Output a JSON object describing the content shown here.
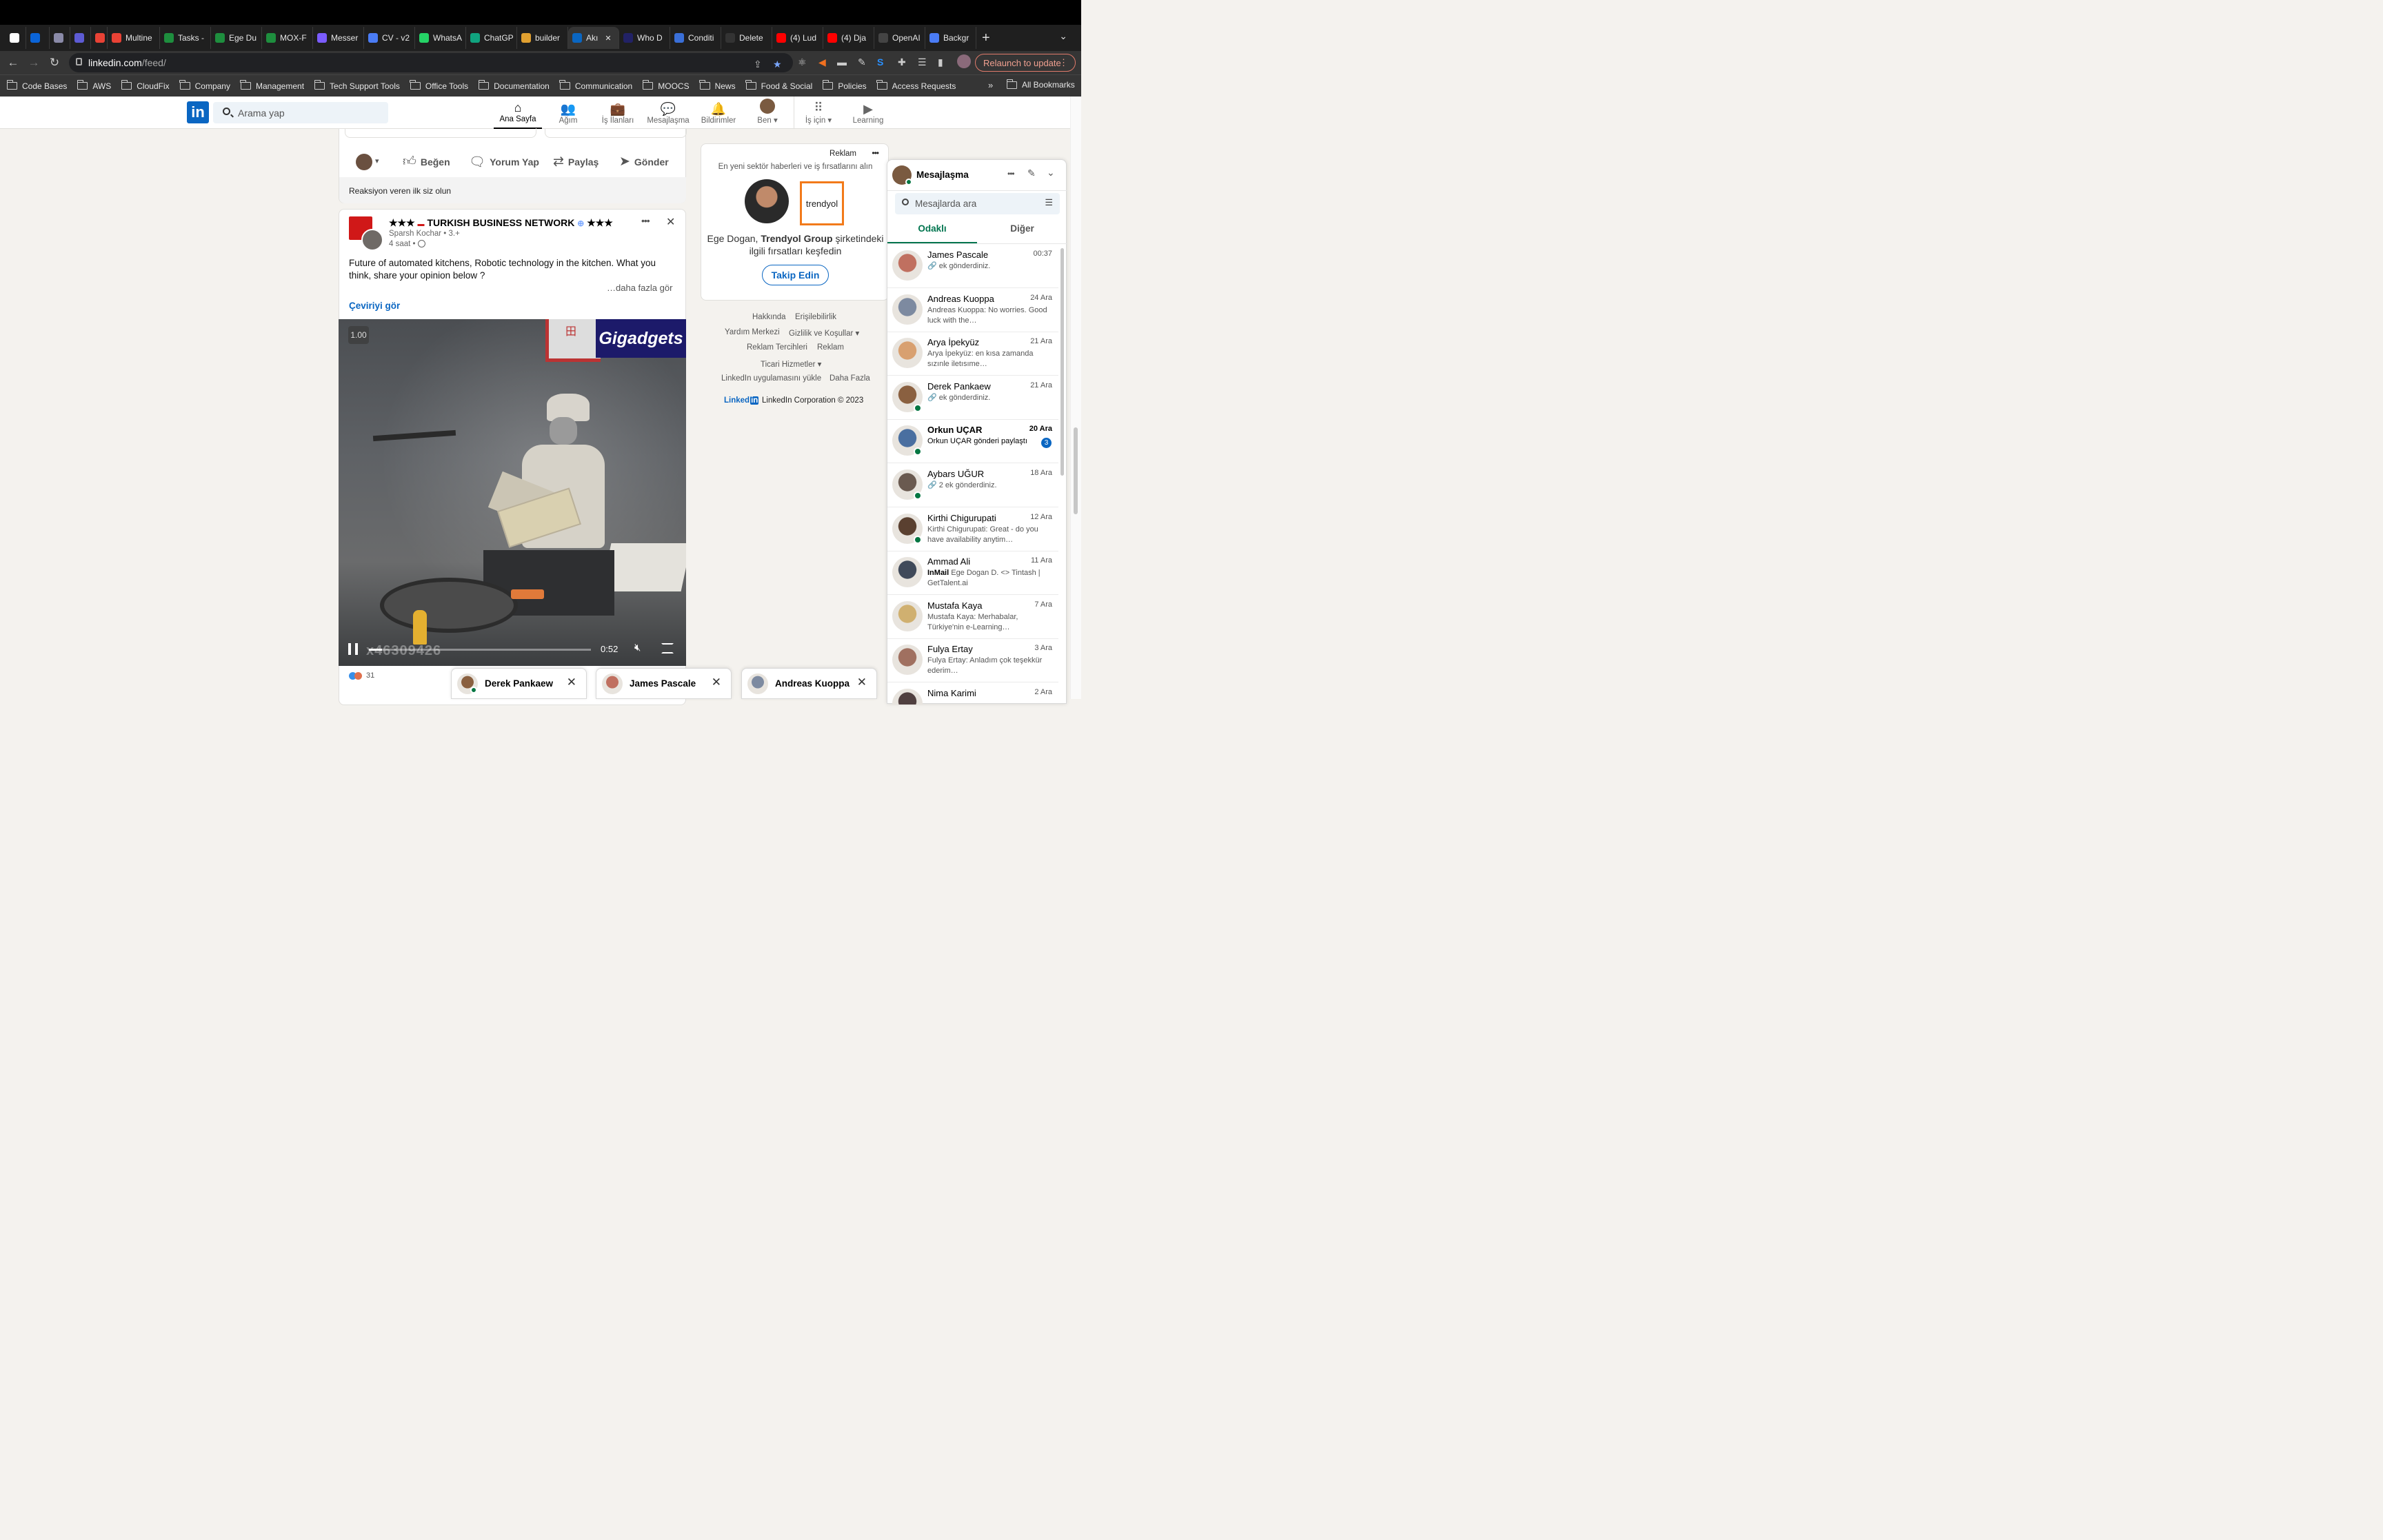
{
  "browser": {
    "tabs": [
      {
        "label": "",
        "color": "#ffffff"
      },
      {
        "label": "",
        "color": "#0a64d8"
      },
      {
        "label": "",
        "color": "#8a8aa8"
      },
      {
        "label": "",
        "color": "#5d5bd4"
      },
      {
        "label": "",
        "color": "#e94235"
      },
      {
        "label": "Multine",
        "color": "#e94235"
      },
      {
        "label": "Tasks -",
        "color": "#1e8e3e"
      },
      {
        "label": "Ege Du",
        "color": "#1e8e3e"
      },
      {
        "label": "MOX-F",
        "color": "#1e8e3e"
      },
      {
        "label": "Messer",
        "color": "#7b5cff"
      },
      {
        "label": "CV - v2",
        "color": "#4a7cf5"
      },
      {
        "label": "WhatsA",
        "color": "#25d366"
      },
      {
        "label": "ChatGP",
        "color": "#10a37f"
      },
      {
        "label": "builder",
        "color": "#e0a030"
      },
      {
        "label": "Akı",
        "color": "#0a66c2"
      },
      {
        "label": "Who D",
        "color": "#222266"
      },
      {
        "label": "Conditi",
        "color": "#3a6fd8"
      },
      {
        "label": "Delete",
        "color": "#333333"
      },
      {
        "label": "(4) Lud",
        "color": "#ff0000"
      },
      {
        "label": "(4) Dja",
        "color": "#ff0000"
      },
      {
        "label": "OpenAI",
        "color": "#444444"
      },
      {
        "label": "Backgr",
        "color": "#4a7cf5"
      }
    ],
    "new_tab": "+",
    "tab_menu": "⌄",
    "url_host": "linkedin.com",
    "url_path": "/feed/",
    "relaunch": "Relaunch to update",
    "relaunch_menu": "⋮",
    "bookmarks": [
      "Code Bases",
      "AWS",
      "CloudFix",
      "Company",
      "Management",
      "Tech Support Tools",
      "Office Tools",
      "Documentation",
      "Communication",
      "MOOCS",
      "News",
      "Food & Social",
      "Policies",
      "Access Requests"
    ],
    "bookmarks_more": "»",
    "all_bookmarks": "All Bookmarks"
  },
  "linkedin": {
    "logo": "in",
    "search_placeholder": "Arama yap",
    "nav": [
      "Ana Sayfa",
      "Ağım",
      "İş İlanları",
      "Mesajlaşma",
      "Bildirimler",
      "Ben",
      "İş için",
      "Learning"
    ]
  },
  "prev_post": {
    "actions": [
      "Beğen",
      "Yorum Yap",
      "Paylaş",
      "Gönder"
    ],
    "first_reaction": "Reaksiyon veren ilk siz olun"
  },
  "post": {
    "stars_left": "★★★",
    "flag": "🇹🇷",
    "page_name": "TURKISH BUSINESS NETWORK",
    "stars_right": "★★★",
    "author": "Sparsh Kochar",
    "degree": "• 3.+",
    "time": "4 saat •",
    "menu": "•••",
    "close": "✕",
    "text": "Future of automated kitchens, Robotic technology in the kitchen. What you think, share your opinion below ?",
    "see_more": "…daha fazla gör",
    "translate": "Çeviriyi gör",
    "video": {
      "speed": "1.00",
      "watermark": "Gigadgets",
      "sign": "田",
      "overlay_id": "x46309426",
      "time": "0:52",
      "progress": 0.06
    },
    "reaction_count": "31"
  },
  "ad": {
    "label": "Reklam",
    "menu": "•••",
    "tagline": "En yeni sektör haberleri ve iş fırsatlarını alın",
    "brand_logo_text": "trendyol",
    "body_prefix": "Ege Dogan, ",
    "body_company": "Trendyol Group",
    "body_suffix": " şirketindeki ilgili fırsatları keşfedin",
    "follow": "Takip Edin"
  },
  "footer": {
    "links": [
      "Hakkında",
      "Erişilebilirlik",
      "Yardım Merkezi",
      "Gizlilik ve Koşullar",
      "Reklam Tercihleri",
      "Reklam",
      "Ticari Hizmetler",
      "LinkedIn uygulamasını yükle",
      "Daha Fazla"
    ],
    "brand": "Linked",
    "brand_in": "in",
    "copyright": "LinkedIn Corporation © 2023"
  },
  "messaging": {
    "title": "Mesajlaşma",
    "menu": "•••",
    "search_placeholder": "Mesajlarda ara",
    "tabs": [
      "Odaklı",
      "Diğer"
    ],
    "conversations": [
      {
        "name": "James Pascale",
        "date": "00:37",
        "preview": "🔗 ek gönderdiniz.",
        "color": "#c07060",
        "online": false,
        "bold": false
      },
      {
        "name": "Andreas Kuoppa",
        "date": "24 Ara",
        "preview": "Andreas Kuoppa: No worries. Good luck with the…",
        "color": "#7d8aa0",
        "online": false,
        "bold": false
      },
      {
        "name": "Arya İpekyüz",
        "date": "21 Ara",
        "preview": "Arya İpekyüz: en kısa zamanda sızınle iletısıme…",
        "color": "#d8a070",
        "online": false,
        "bold": false
      },
      {
        "name": "Derek Pankaew",
        "date": "21 Ara",
        "preview": "🔗 ek gönderdiniz.",
        "color": "#8a6040",
        "online": true,
        "bold": false
      },
      {
        "name": "Orkun UÇAR",
        "date": "20 Ara",
        "preview": "Orkun UÇAR gönderi paylaştı",
        "color": "#4a6fa0",
        "online": true,
        "bold": true,
        "badge": "3"
      },
      {
        "name": "Aybars UĞUR",
        "date": "18 Ara",
        "preview": "🔗 2 ek gönderdiniz.",
        "color": "#6a5a50",
        "online": true,
        "bold": false
      },
      {
        "name": "Kirthi Chigurupati",
        "date": "12 Ara",
        "preview": "Kirthi Chigurupati: Great - do you have availability anytim…",
        "color": "#5a4030",
        "online": true,
        "bold": false
      },
      {
        "name": "Ammad Ali",
        "date": "11 Ara",
        "preview_tag": "InMail",
        "preview": " Ege Dogan D. <> Tintash | GetTalent.ai",
        "color": "#404a5a",
        "online": false,
        "bold": false
      },
      {
        "name": "Mustafa Kaya",
        "date": "7 Ara",
        "preview": "Mustafa Kaya: Merhabalar, Türkiye'nin e-Learning…",
        "color": "#d0b070",
        "online": false,
        "bold": false
      },
      {
        "name": "Fulya Ertay",
        "date": "3 Ara",
        "preview": "Fulya Ertay: Anladım çok teşekkür ederim…",
        "color": "#a07060",
        "online": false,
        "bold": false
      },
      {
        "name": "Nima Karimi",
        "date": "2 Ara",
        "preview": "",
        "color": "#504040",
        "online": false,
        "bold": false
      }
    ]
  },
  "chat_bubbles": [
    {
      "name": "Derek Pankaew",
      "close": "✕",
      "color": "#8a6040"
    },
    {
      "name": "James Pascale",
      "close": "✕",
      "color": "#c07060"
    },
    {
      "name": "Andreas Kuoppa",
      "close": "✕",
      "color": "#7d8aa0"
    }
  ]
}
